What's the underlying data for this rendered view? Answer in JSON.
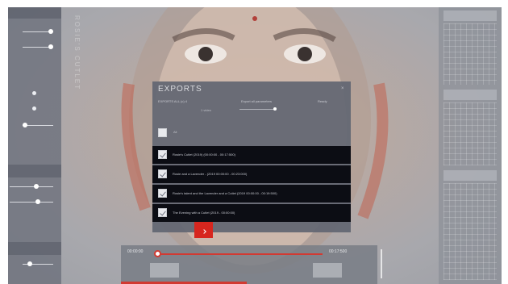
{
  "dialog": {
    "title": "EXPORTS",
    "close_label": "×",
    "sub_left": "EXPORTS ALL (c) 4",
    "sub_mid": "Export all parameters",
    "sub_right": "Ready",
    "sub_small": "1 video",
    "select_all_label": "All",
    "rows": [
      {
        "label": "Rosie's Cutlet (2019) (00:00:00 - 00:17:500)",
        "checked": true
      },
      {
        "label": "Rosie and a Lavender - (2019 00:00:00 - 00:23:000)",
        "checked": true
      },
      {
        "label": "Rosie's talent and the Lavender and a Cutlet (2019 00:00:00 - 00:19:500)",
        "checked": true
      },
      {
        "label": "The Evening with a Cutlet (2019 - 00:00:00)",
        "checked": true
      }
    ]
  },
  "timeline": {
    "start_time": "00:00:00",
    "end_time": "00:17:500",
    "progress": 0.49
  },
  "vertical_text": "ROSIE'S CUTLET",
  "colors": {
    "accent": "#d7261e",
    "dialog_bg": "#626672",
    "row_bg": "#0c0d14"
  },
  "icons": {
    "export": "arrow-down-right-icon",
    "close": "close-icon",
    "checkbox": "checkbox-checked-icon"
  }
}
